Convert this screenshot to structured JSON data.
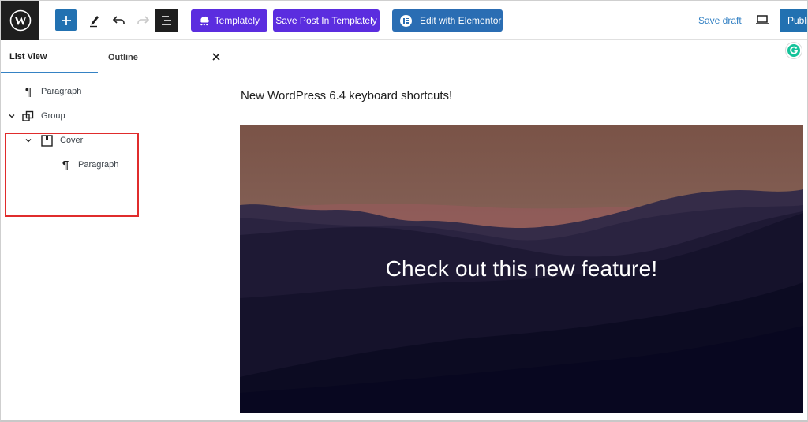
{
  "header": {
    "logo": "wordpress-logo",
    "add_block_icon": "plus-icon",
    "tools_icon": "pencil-icon",
    "undo_icon": "undo-icon",
    "redo_icon": "redo-icon",
    "list_view_icon": "list-view-icon",
    "templately_label": "Templately",
    "save_templately_label": "Save Post In Templately",
    "elementor_label": "Edit with Elementor",
    "save_draft_label": "Save draft",
    "preview_icon": "laptop-icon",
    "publish_label": "Publish"
  },
  "sidebar": {
    "tabs": [
      {
        "label": "List View",
        "active": true
      },
      {
        "label": "Outline",
        "active": false
      }
    ],
    "close_icon": "close-icon",
    "tree": [
      {
        "label": "Paragraph",
        "icon": "paragraph-icon",
        "level": 0,
        "expandable": false
      },
      {
        "label": "Group",
        "icon": "group-icon",
        "level": 0,
        "expandable": true,
        "expanded": true
      },
      {
        "label": "Cover",
        "icon": "cover-icon",
        "level": 1,
        "expandable": true,
        "expanded": true
      },
      {
        "label": "Paragraph",
        "icon": "paragraph-icon",
        "level": 2,
        "expandable": false
      }
    ]
  },
  "canvas": {
    "paragraph_text": "New WordPress 6.4 keyboard shortcuts!",
    "cover_text": "Check out this new feature!",
    "grammarly_icon": "grammarly-icon"
  },
  "colors": {
    "primary_blue": "#2271b1",
    "templately_purple": "#5b2ddf",
    "elementor_blue": "#2a6db3",
    "highlight_red": "#e02c2c",
    "grammarly_green": "#15c39a"
  }
}
